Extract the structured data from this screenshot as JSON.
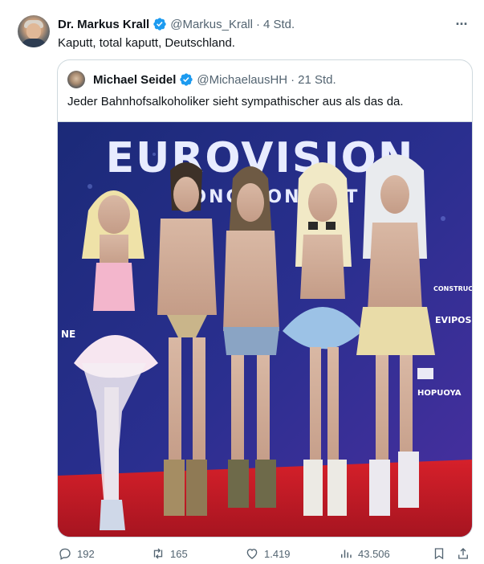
{
  "tweet": {
    "author_name": "Dr. Markus Krall",
    "author_handle": "@Markus_Krall",
    "separator": "·",
    "time": "4 Std.",
    "text": "Kaputt, total kaputt, Deutschland.",
    "more_label": "···"
  },
  "quoted": {
    "author_name": "Michael Seidel",
    "author_handle": "@MichaelausHH",
    "separator": "·",
    "time": "21 Std.",
    "text": "Jeder Bahnhofsalkoholiker sieht sympathischer aus als das da.",
    "image": {
      "banner_text_1": "EUROVISION",
      "banner_text_2": "SONG CONTEST",
      "side_text": [
        "NE",
        "CONSTRUCTION",
        "EVIPOSNA",
        "HOPUOYA"
      ]
    }
  },
  "metrics": {
    "replies": "192",
    "reposts": "165",
    "likes": "1.419",
    "views": "43.506"
  },
  "icons": [
    "verified-badge-icon",
    "more-icon",
    "reply-icon",
    "repost-icon",
    "like-icon",
    "views-icon",
    "bookmark-icon",
    "share-icon"
  ],
  "colors": {
    "verified": "#1d9bf0",
    "secondary_text": "#536471",
    "border": "#cfd9de"
  }
}
